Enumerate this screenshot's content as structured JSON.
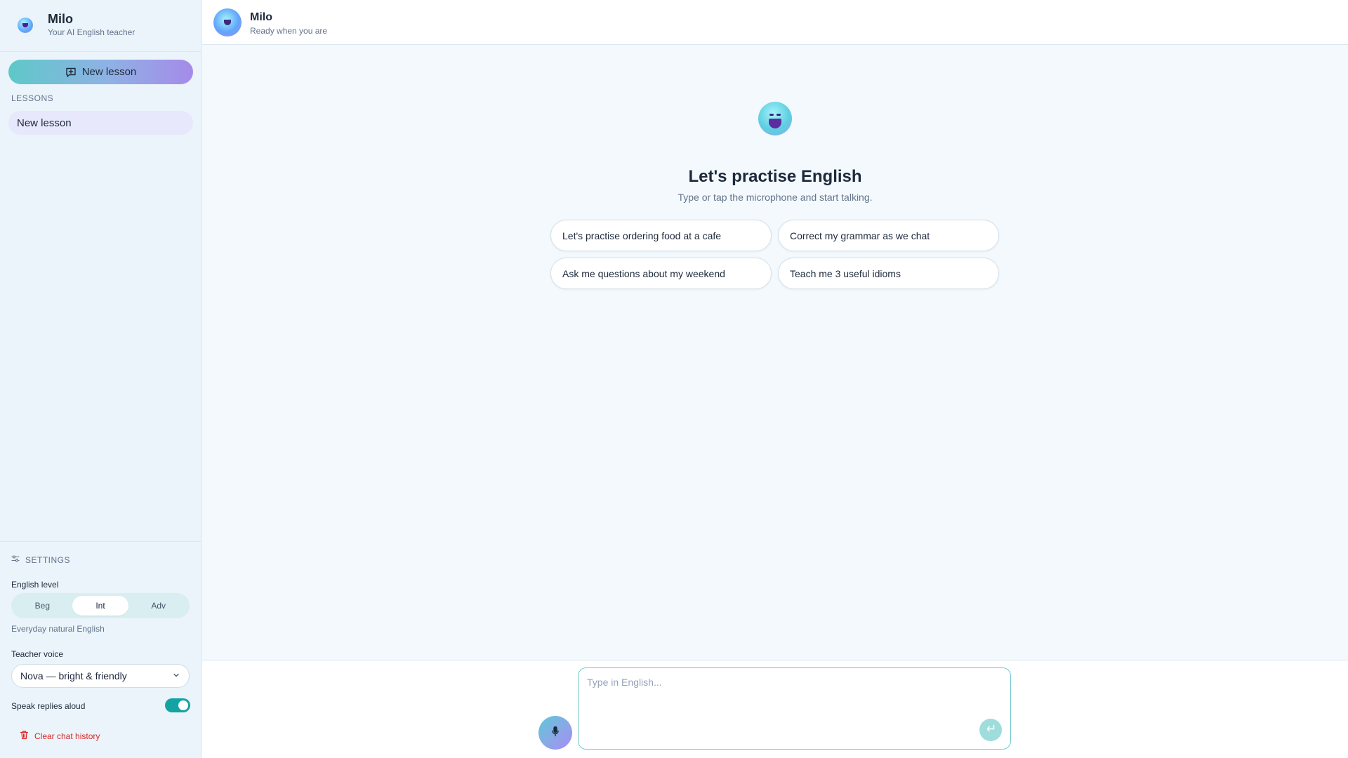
{
  "brand": {
    "name": "Milo",
    "tagline": "Your AI English teacher"
  },
  "sidebar": {
    "new_lesson_label": "New lesson",
    "lessons_heading": "LESSONS",
    "lessons": [
      {
        "label": "New lesson",
        "selected": true
      }
    ]
  },
  "settings": {
    "heading": "SETTINGS",
    "level_label": "English level",
    "levels": [
      "Beg",
      "Int",
      "Adv"
    ],
    "selected_level": "Int",
    "level_description": "Everyday natural English",
    "voice_label": "Teacher voice",
    "voice_value": "Nova — bright & friendly",
    "speak_label": "Speak replies aloud",
    "speak_enabled": true,
    "clear_label": "Clear chat history"
  },
  "header": {
    "name": "Milo",
    "status": "Ready when you are"
  },
  "welcome": {
    "title": "Let's practise English",
    "subtitle": "Type or tap the microphone and start talking.",
    "prompts": [
      "Let's practise ordering food at a cafe",
      "Correct my grammar as we chat",
      "Ask me questions about my weekend",
      "Teach me 3 useful idioms"
    ]
  },
  "composer": {
    "placeholder": "Type in English...",
    "value": ""
  },
  "colors": {
    "accent": "#14a3a3",
    "gradient_start": "#5ec8c8",
    "gradient_end": "#a58ae8",
    "danger": "#dc2626",
    "selected_lesson_bg": "#e7e8fb"
  },
  "icons": {
    "new_lesson": "message-plus-icon",
    "settings": "sliders-icon",
    "select": "chevron-down-icon",
    "clear": "trash-icon",
    "mic": "microphone-icon",
    "send": "enter-return-icon"
  }
}
